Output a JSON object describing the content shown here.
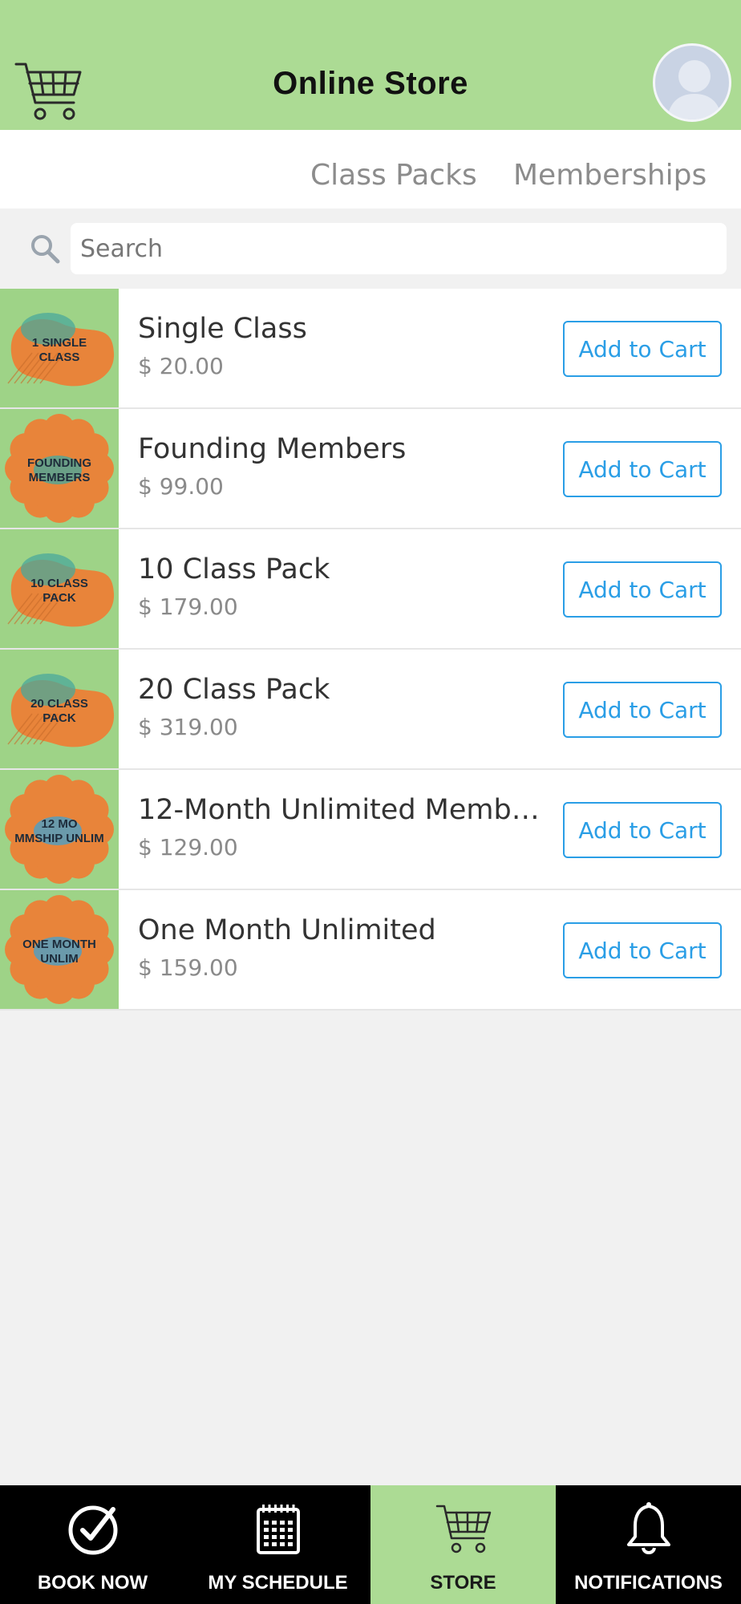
{
  "header": {
    "title": "Online Store",
    "cart_icon": "cart-icon",
    "avatar_icon": "user-avatar",
    "background": "#acdb94"
  },
  "tabs": [
    {
      "label": "Class Packs"
    },
    {
      "label": "Memberships"
    }
  ],
  "search": {
    "placeholder": "Search",
    "icon": "search-icon"
  },
  "products": [
    {
      "name": "Single Class",
      "price": "$ 20.00",
      "button": "Add to Cart",
      "thumb": {
        "shape": "blob",
        "color": "#e8843a",
        "accent": "#4aa89b",
        "line1": "1 SINGLE",
        "line2": "CLASS"
      }
    },
    {
      "name": "Founding Members",
      "price": "$ 99.00",
      "button": "Add to Cart",
      "thumb": {
        "shape": "flower",
        "color": "#e8843a",
        "accent": "#4aa89b",
        "line1": "FOUNDING",
        "line2": "MEMBERS"
      }
    },
    {
      "name": "10 Class Pack",
      "price": "$ 179.00",
      "button": "Add to Cart",
      "thumb": {
        "shape": "blob",
        "color": "#e8843a",
        "accent": "#4aa89b",
        "line1": "10 CLASS",
        "line2": "PACK"
      }
    },
    {
      "name": "20 Class Pack",
      "price": "$ 319.00",
      "button": "Add to Cart",
      "thumb": {
        "shape": "blob",
        "color": "#e8843a",
        "accent": "#4aa89b",
        "line1": "20 CLASS",
        "line2": "PACK"
      }
    },
    {
      "name": "12-Month Unlimited Membe...",
      "price": "$ 129.00",
      "button": "Add to Cart",
      "thumb": {
        "shape": "flower",
        "color": "#e8843a",
        "accent": "#4aa0c8",
        "line1": "12 MO",
        "line2": "MMSHIP UNLIM"
      }
    },
    {
      "name": "One Month Unlimited",
      "price": "$ 159.00",
      "button": "Add to Cart",
      "thumb": {
        "shape": "flower",
        "color": "#e8843a",
        "accent": "#4aa0c8",
        "line1": "ONE MONTH",
        "line2": "UNLIM"
      }
    }
  ],
  "bottom_nav": [
    {
      "label": "BOOK NOW",
      "icon": "check-circle-icon",
      "active": false
    },
    {
      "label": "MY SCHEDULE",
      "icon": "calendar-icon",
      "active": false
    },
    {
      "label": "STORE",
      "icon": "cart-icon",
      "active": true
    },
    {
      "label": "NOTIFICATIONS",
      "icon": "bell-icon",
      "active": false
    }
  ]
}
